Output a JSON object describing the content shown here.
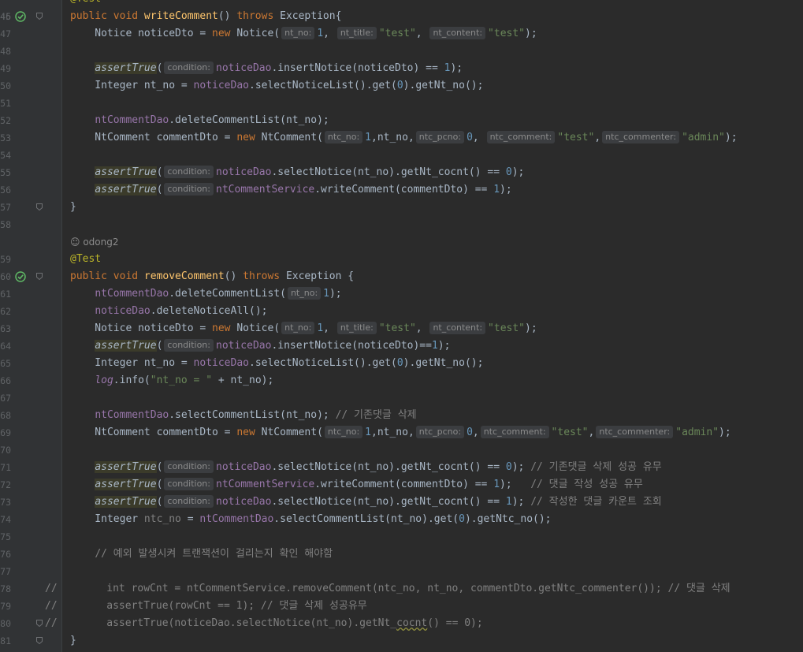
{
  "editor": {
    "lines": [
      {
        "n": "46",
        "marker": "run",
        "fold": true,
        "tokens": [
          [
            "kw",
            "public void "
          ],
          [
            "fn",
            "writeComment"
          ],
          [
            "",
            "() "
          ],
          [
            "kw",
            "throws "
          ],
          [
            "",
            "Exception{"
          ]
        ]
      },
      {
        "n": "47",
        "tokens": [
          [
            "",
            "    Notice noticeDto = "
          ],
          [
            "kw",
            "new "
          ],
          [
            "",
            "Notice("
          ],
          [
            "hint",
            "nt_no:"
          ],
          [
            "num",
            "1"
          ],
          [
            "",
            ", "
          ],
          [
            "hint",
            "nt_title:"
          ],
          [
            "str",
            "\"test\""
          ],
          [
            "",
            ", "
          ],
          [
            "hint",
            "nt_content:"
          ],
          [
            "str",
            "\"test\""
          ],
          [
            "",
            ");"
          ]
        ]
      },
      {
        "n": "48",
        "tokens": []
      },
      {
        "n": "49",
        "tokens": [
          [
            "",
            "    "
          ],
          [
            "at",
            "assertTrue"
          ],
          [
            "",
            "("
          ],
          [
            "hint",
            "condition:"
          ],
          [
            "fld",
            "noticeDao"
          ],
          [
            "",
            ".insertNotice(noticeDto) == "
          ],
          [
            "num",
            "1"
          ],
          [
            "",
            ");"
          ]
        ]
      },
      {
        "n": "50",
        "tokens": [
          [
            "",
            "    Integer nt_no = "
          ],
          [
            "fld",
            "noticeDao"
          ],
          [
            "",
            ".selectNoticeList().get("
          ],
          [
            "num",
            "0"
          ],
          [
            "",
            ").getNt_no();"
          ]
        ]
      },
      {
        "n": "51",
        "tokens": []
      },
      {
        "n": "52",
        "tokens": [
          [
            "",
            "    "
          ],
          [
            "fld",
            "ntCommentDao"
          ],
          [
            "",
            ".deleteCommentList(nt_no);"
          ]
        ]
      },
      {
        "n": "53",
        "tokens": [
          [
            "",
            "    NtComment commentDto = "
          ],
          [
            "kw",
            "new "
          ],
          [
            "",
            "NtComment("
          ],
          [
            "hint",
            "ntc_no:"
          ],
          [
            "num",
            "1"
          ],
          [
            "",
            ",nt_no,"
          ],
          [
            "hint",
            "ntc_pcno:"
          ],
          [
            "num",
            "0"
          ],
          [
            "",
            ", "
          ],
          [
            "hint",
            "ntc_comment:"
          ],
          [
            "str",
            "\"test\""
          ],
          [
            "",
            ","
          ],
          [
            "hint",
            "ntc_commenter:"
          ],
          [
            "str",
            "\"admin\""
          ],
          [
            "",
            ");"
          ]
        ]
      },
      {
        "n": "54",
        "tokens": []
      },
      {
        "n": "55",
        "tokens": [
          [
            "",
            "    "
          ],
          [
            "at",
            "assertTrue"
          ],
          [
            "",
            "("
          ],
          [
            "hint",
            "condition:"
          ],
          [
            "fld",
            "noticeDao"
          ],
          [
            "",
            ".selectNotice(nt_no).getNt_cocnt() == "
          ],
          [
            "num",
            "0"
          ],
          [
            "",
            ");"
          ]
        ]
      },
      {
        "n": "56",
        "tokens": [
          [
            "",
            "    "
          ],
          [
            "at",
            "assertTrue"
          ],
          [
            "",
            "("
          ],
          [
            "hint",
            "condition:"
          ],
          [
            "fld",
            "ntCommentService"
          ],
          [
            "",
            ".writeComment(commentDto) == "
          ],
          [
            "num",
            "1"
          ],
          [
            "",
            ");"
          ]
        ]
      },
      {
        "n": "57",
        "fold": true,
        "tokens": [
          [
            "",
            "}"
          ]
        ]
      },
      {
        "n": "58",
        "tokens": []
      },
      {
        "n": "",
        "tokens": [
          [
            "usage",
            "☺ odong2"
          ]
        ]
      },
      {
        "n": "59",
        "tokens": [
          [
            "ann",
            "@Test"
          ]
        ]
      },
      {
        "n": "60",
        "marker": "run",
        "fold": true,
        "tokens": [
          [
            "kw",
            "public void "
          ],
          [
            "fn",
            "removeComment"
          ],
          [
            "",
            "() "
          ],
          [
            "kw",
            "throws "
          ],
          [
            "",
            "Exception {"
          ]
        ]
      },
      {
        "n": "61",
        "tokens": [
          [
            "",
            "    "
          ],
          [
            "fld",
            "ntCommentDao"
          ],
          [
            "",
            ".deleteCommentList("
          ],
          [
            "hint",
            "nt_no:"
          ],
          [
            "num",
            "1"
          ],
          [
            "",
            ");"
          ]
        ]
      },
      {
        "n": "62",
        "tokens": [
          [
            "",
            "    "
          ],
          [
            "fld",
            "noticeDao"
          ],
          [
            "",
            ".deleteNoticeAll();"
          ]
        ]
      },
      {
        "n": "63",
        "tokens": [
          [
            "",
            "    Notice noticeDto = "
          ],
          [
            "kw",
            "new "
          ],
          [
            "",
            "Notice("
          ],
          [
            "hint",
            "nt_no:"
          ],
          [
            "num",
            "1"
          ],
          [
            "",
            ", "
          ],
          [
            "hint",
            "nt_title:"
          ],
          [
            "str",
            "\"test\""
          ],
          [
            "",
            ", "
          ],
          [
            "hint",
            "nt_content:"
          ],
          [
            "str",
            "\"test\""
          ],
          [
            "",
            ");"
          ]
        ]
      },
      {
        "n": "64",
        "tokens": [
          [
            "",
            "    "
          ],
          [
            "at",
            "assertTrue"
          ],
          [
            "",
            "("
          ],
          [
            "hint",
            "condition:"
          ],
          [
            "fld",
            "noticeDao"
          ],
          [
            "",
            ".insertNotice(noticeDto)=="
          ],
          [
            "num",
            "1"
          ],
          [
            "",
            ");"
          ]
        ]
      },
      {
        "n": "65",
        "tokens": [
          [
            "",
            "    Integer nt_no = "
          ],
          [
            "fld",
            "noticeDao"
          ],
          [
            "",
            ".selectNoticeList().get("
          ],
          [
            "num",
            "0"
          ],
          [
            "",
            ").getNt_no();"
          ]
        ]
      },
      {
        "n": "66",
        "tokens": [
          [
            "",
            "    "
          ],
          [
            "fldi",
            "log"
          ],
          [
            "",
            ".info("
          ],
          [
            "str",
            "\"nt_no = \""
          ],
          [
            "",
            " + nt_no);"
          ]
        ]
      },
      {
        "n": "67",
        "tokens": []
      },
      {
        "n": "68",
        "tokens": [
          [
            "",
            "    "
          ],
          [
            "fld",
            "ntCommentDao"
          ],
          [
            "",
            ".selectCommentList(nt_no); "
          ],
          [
            "cmt",
            "// 기존댓글 삭제"
          ]
        ]
      },
      {
        "n": "69",
        "tokens": [
          [
            "",
            "    NtComment commentDto = "
          ],
          [
            "kw",
            "new "
          ],
          [
            "",
            "NtComment("
          ],
          [
            "hint",
            "ntc_no:"
          ],
          [
            "num",
            "1"
          ],
          [
            "",
            ",nt_no,"
          ],
          [
            "hint",
            "ntc_pcno:"
          ],
          [
            "num",
            "0"
          ],
          [
            "",
            ","
          ],
          [
            "hint",
            "ntc_comment:"
          ],
          [
            "str",
            "\"test\""
          ],
          [
            "",
            ","
          ],
          [
            "hint",
            "ntc_commenter:"
          ],
          [
            "str",
            "\"admin\""
          ],
          [
            "",
            ");"
          ]
        ]
      },
      {
        "n": "70",
        "tokens": []
      },
      {
        "n": "71",
        "tokens": [
          [
            "",
            "    "
          ],
          [
            "at",
            "assertTrue"
          ],
          [
            "",
            "("
          ],
          [
            "hint",
            "condition:"
          ],
          [
            "fld",
            "noticeDao"
          ],
          [
            "",
            ".selectNotice(nt_no).getNt_cocnt() == "
          ],
          [
            "num",
            "0"
          ],
          [
            "",
            "); "
          ],
          [
            "cmt",
            "// 기존댓글 삭제 성공 유무"
          ]
        ]
      },
      {
        "n": "72",
        "tokens": [
          [
            "",
            "    "
          ],
          [
            "at",
            "assertTrue"
          ],
          [
            "",
            "("
          ],
          [
            "hint",
            "condition:"
          ],
          [
            "fld",
            "ntCommentService"
          ],
          [
            "",
            ".writeComment(commentDto) == "
          ],
          [
            "num",
            "1"
          ],
          [
            "",
            ");   "
          ],
          [
            "cmt",
            "// 댓글 작성 성공 유무"
          ]
        ]
      },
      {
        "n": "73",
        "tokens": [
          [
            "",
            "    "
          ],
          [
            "at",
            "assertTrue"
          ],
          [
            "",
            "("
          ],
          [
            "hint",
            "condition:"
          ],
          [
            "fld",
            "noticeDao"
          ],
          [
            "",
            ".selectNotice(nt_no).getNt_cocnt() == "
          ],
          [
            "num",
            "1"
          ],
          [
            "",
            "); "
          ],
          [
            "cmt",
            "// 작성한 댓글 카운트 조회"
          ]
        ]
      },
      {
        "n": "74",
        "tokens": [
          [
            "",
            "    Integer "
          ],
          [
            "grey",
            "ntc_no"
          ],
          [
            "",
            " = "
          ],
          [
            "fld",
            "ntCommentDao"
          ],
          [
            "",
            ".selectCommentList(nt_no).get("
          ],
          [
            "num",
            "0"
          ],
          [
            "",
            ").getNtc_no();"
          ]
        ]
      },
      {
        "n": "75",
        "tokens": []
      },
      {
        "n": "76",
        "tokens": [
          [
            "",
            "    "
          ],
          [
            "cmt",
            "// 예외 발생시켜 트랜잭션이 걸리는지 확인 해야함"
          ]
        ]
      },
      {
        "n": "77",
        "tokens": []
      },
      {
        "n": "78",
        "commented": true,
        "tokens": [
          [
            "cmt",
            "//        int rowCnt = ntCommentService.removeComment(ntc_no, nt_no, commentDto.getNtc_commenter()); // 댓글 삭제"
          ]
        ]
      },
      {
        "n": "79",
        "commented": true,
        "tokens": [
          [
            "cmt",
            "//        assertTrue(rowCnt == 1); // 댓글 삭제 성공유무"
          ]
        ]
      },
      {
        "n": "80",
        "commented": true,
        "fold": true,
        "tokens": [
          [
            "cmt",
            "//        assertTrue(noticeDao.selectNotice(nt_no).getNt_"
          ],
          [
            "cmtw",
            "cocnt"
          ],
          [
            "cmt",
            "() == 0);"
          ]
        ]
      },
      {
        "n": "81",
        "fold": true,
        "tokens": [
          [
            "",
            "}"
          ]
        ]
      }
    ],
    "top_partial": "@Test"
  },
  "icons": {
    "run": "test-passed-run-icon",
    "fold": "fold-marker-icon"
  },
  "colors": {
    "background": "#2b2b2b",
    "gutter": "#313335",
    "keyword": "#cc7832",
    "method": "#ffc66d",
    "field": "#9876aa",
    "number": "#6897bb",
    "string": "#6a8759",
    "comment": "#808080",
    "annotation": "#bbb529",
    "check": "#5fb865"
  }
}
